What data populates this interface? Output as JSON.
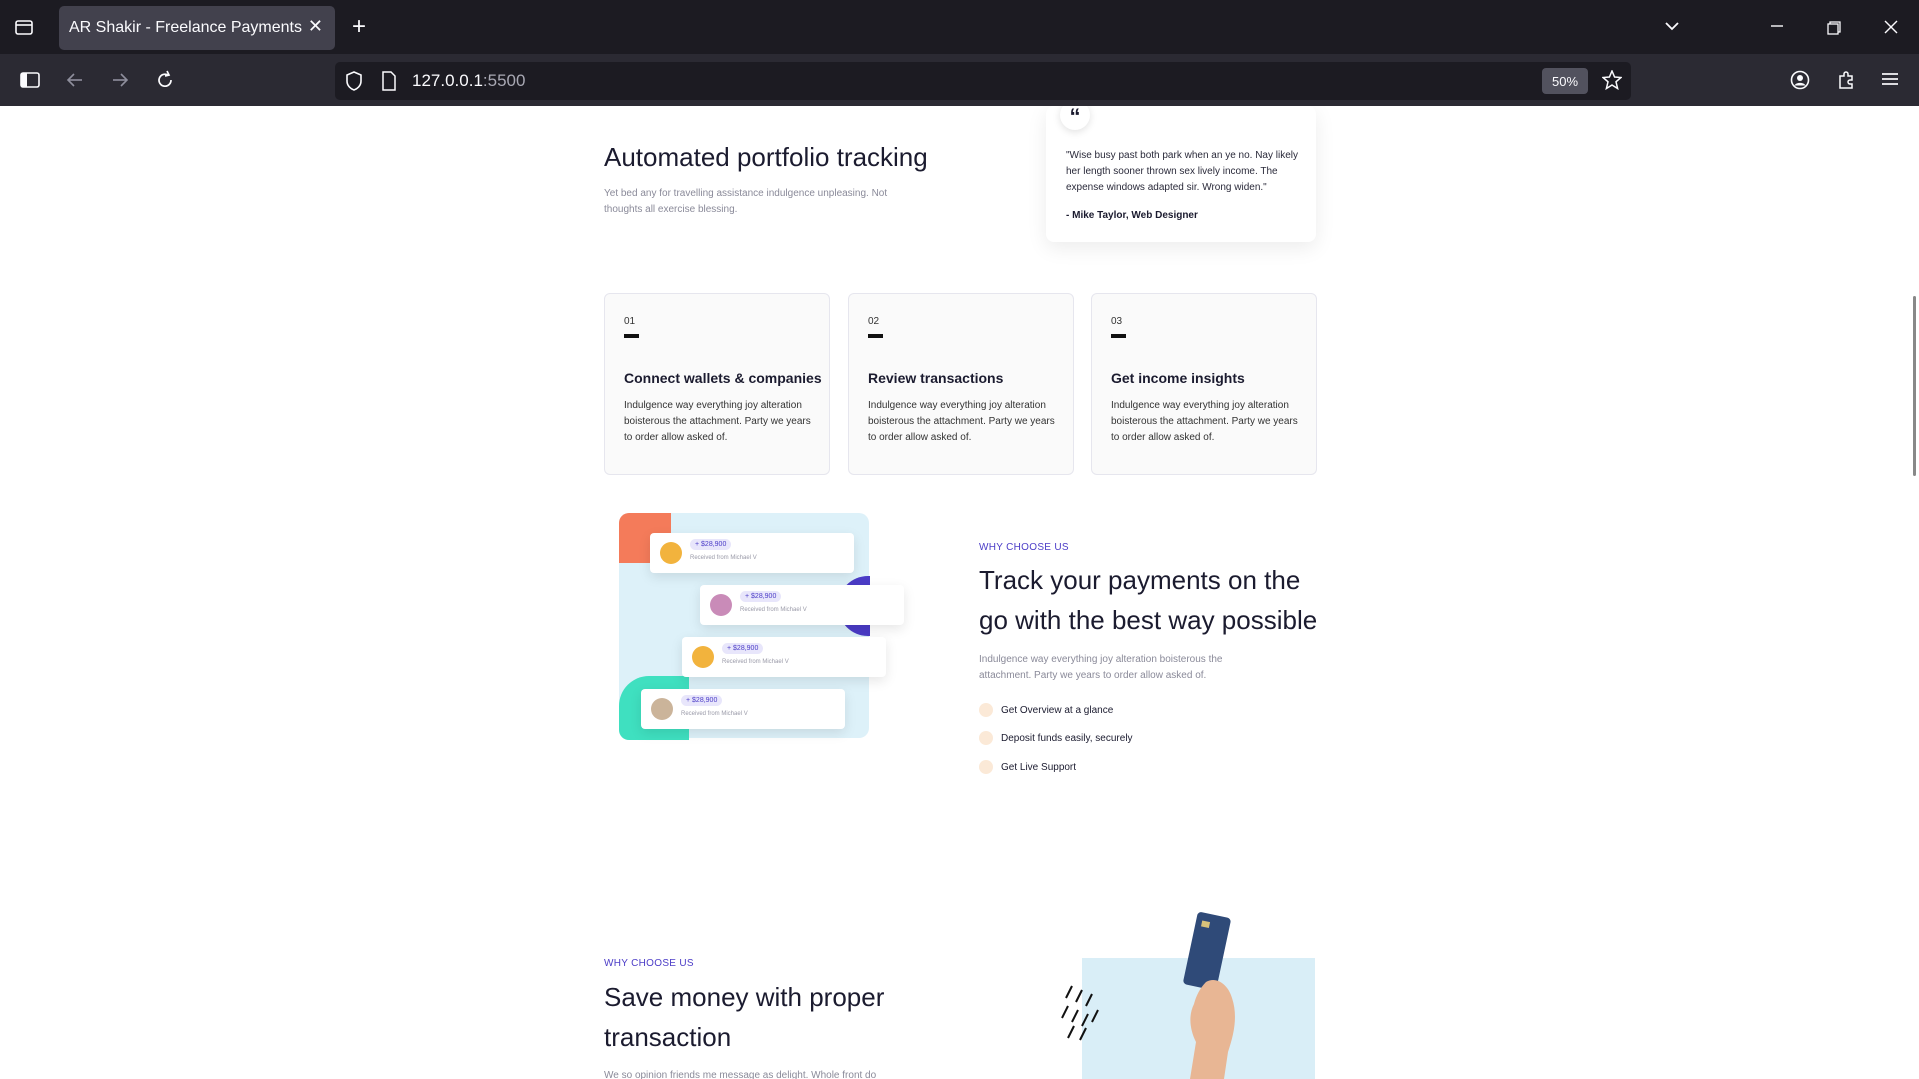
{
  "browser": {
    "tab_title": "AR Shakir - Freelance Payments",
    "url_host": "127.0.0.1",
    "url_port": ":5500",
    "zoom": "50%"
  },
  "quote": {
    "mark": "“",
    "text": "\"Wise busy past both park when an ye no. Nay likely her length sooner thrown sex lively income. The expense windows adapted sir. Wrong widen.\"",
    "author": "- Mike Taylor, Web Designer"
  },
  "portfolio": {
    "title": "Automated portfolio tracking",
    "subtitle": "Yet bed any for travelling assistance indulgence unpleasing. Not thoughts all exercise blessing."
  },
  "steps": [
    {
      "num": "01",
      "title": "Connect wallets & companies",
      "text": "Indulgence way everything joy alteration boisterous the attachment. Party we years to order allow asked of."
    },
    {
      "num": "02",
      "title": "Review transactions",
      "text": "Indulgence way everything joy alteration boisterous the attachment. Party we years to order allow asked of."
    },
    {
      "num": "03",
      "title": "Get income insights",
      "text": "Indulgence way everything joy alteration boisterous the attachment. Party we years to order allow asked of."
    }
  ],
  "payments": [
    {
      "amount": "+ $28,900",
      "from": "Received from Michael V"
    },
    {
      "amount": "+ $28,900",
      "from": "Received from Michael V"
    },
    {
      "amount": "+ $28,900",
      "from": "Received from Michael V"
    },
    {
      "amount": "+ $28,900",
      "from": "Received from Michael V"
    }
  ],
  "track": {
    "eyebrow": "WHY CHOOSE US",
    "title_line1": "Track your payments on the",
    "title_line2": "go with the best way possible",
    "subtitle": "Indulgence way everything joy alteration boisterous the attachment. Party we years to order allow asked of.",
    "features": [
      "Get Overview at a glance",
      "Deposit funds easily, securely",
      "Get Live Support"
    ]
  },
  "save": {
    "eyebrow": "WHY CHOOSE US",
    "title_line1": "Save money with proper",
    "title_line2": "transaction",
    "subtitle": "We so opinion friends me message as delight. Whole front do"
  },
  "colors": {
    "accent": "#4b3cc7",
    "light_blue": "#ddf1f9",
    "coral": "#f47b5a",
    "teal": "#3fe0c0"
  }
}
